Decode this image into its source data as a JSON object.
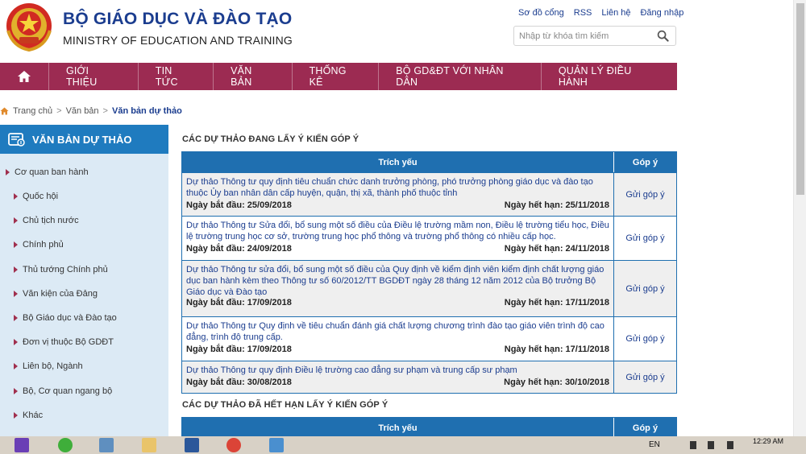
{
  "header": {
    "title": "BỘ GIÁO DỤC VÀ ĐÀO TẠO",
    "subtitle": "MINISTRY OF EDUCATION AND TRAINING",
    "top_links": [
      "Sơ đồ cổng",
      "RSS",
      "Liên hệ",
      "Đăng nhập"
    ],
    "search_placeholder": "Nhập từ khóa tìm kiếm"
  },
  "nav": {
    "home_icon": "home-icon",
    "items": [
      "GIỚI THIỆU",
      "TIN TỨC",
      "VĂN BẢN",
      "THỐNG KÊ",
      "BỘ GD&ĐT VỚI NHÂN DÂN",
      "QUẢN LÝ ĐIỀU HÀNH"
    ]
  },
  "breadcrumb": {
    "home": "Trang chủ",
    "level1": "Văn bản",
    "current": "Văn bản dự thảo",
    "separator": ">"
  },
  "sidebar": {
    "title": "VĂN BẢN DỰ THẢO",
    "root": "Cơ quan ban hành",
    "items": [
      "Quốc hội",
      "Chủ tịch nước",
      "Chính phủ",
      "Thủ tướng Chính phủ",
      "Văn kiện của Đảng",
      "Bộ Giáo dục và Đào tạo",
      "Đơn vị thuộc Bộ GDĐT",
      "Liên bộ, Ngành",
      "Bộ, Cơ quan ngang bộ",
      "Khác"
    ]
  },
  "open_section": {
    "title": "CÁC DỰ THẢO ĐANG LẤY Ý KIẾN GÓP Ý",
    "col_summary": "Trích yếu",
    "col_feedback": "Góp ý",
    "rows": [
      {
        "title": "Dự thảo Thông tư quy định tiêu chuẩn chức danh trưởng phòng, phó trưởng phòng giáo dục và đào tạo thuộc Ủy ban nhân dân cấp huyện, quận, thị xã, thành phố thuộc tỉnh",
        "start": "Ngày bắt đầu: 25/09/2018",
        "end": "Ngày hết hạn: 25/11/2018",
        "action": "Gửi góp ý"
      },
      {
        "title": "Dự thảo Thông tư Sửa đổi, bổ sung một số điều của Điều lệ trường mầm non, Điều lệ trường tiểu học, Điều lệ trường trung học cơ sở, trường trung học phổ thông và trường phổ thông có nhiều cấp học.",
        "start": "Ngày bắt đầu: 24/09/2018",
        "end": "Ngày hết hạn: 24/11/2018",
        "action": "Gửi góp ý"
      },
      {
        "title": "Dự thảo Thông tư sửa đổi, bổ sung một số điều của Quy định về kiểm định viên kiểm định chất lượng giáo dục ban hành kèm theo Thông tư số 60/2012/TT BGDĐT ngày 28 tháng 12 năm 2012 của Bộ trưởng Bộ Giáo dục và Đào tạo",
        "start": "Ngày bắt đầu: 17/09/2018",
        "end": "Ngày hết hạn: 17/11/2018",
        "action": "Gửi góp ý"
      },
      {
        "title": "Dự thảo Thông tư Quy định về tiêu chuẩn đánh giá chất lượng chương trình đào tạo giáo viên trình độ cao đẳng, trình độ trung cấp.",
        "start": "Ngày bắt đầu: 17/09/2018",
        "end": "Ngày hết hạn: 17/11/2018",
        "action": "Gửi góp ý"
      },
      {
        "title": "Dự thảo Thông tư quy định Điều lệ trường cao đẳng sư phạm và trung cấp sư phạm",
        "start": "Ngày bắt đầu: 30/08/2018",
        "end": "Ngày hết hạn: 30/10/2018",
        "action": "Gửi góp ý"
      }
    ]
  },
  "closed_section": {
    "title": "CÁC DỰ THẢO ĐÃ HẾT HẠN LẤY Ý KIẾN GÓP Ý",
    "col_summary": "Trích yếu",
    "col_feedback": "Góp ý"
  },
  "taskbar": {
    "lang": "EN",
    "time": "12:29 AM"
  },
  "colors": {
    "nav_bg": "#9c2b52",
    "primary_blue": "#1f6fb0",
    "sidebar_bg": "#dceaf5",
    "link": "#1b3d8f"
  }
}
